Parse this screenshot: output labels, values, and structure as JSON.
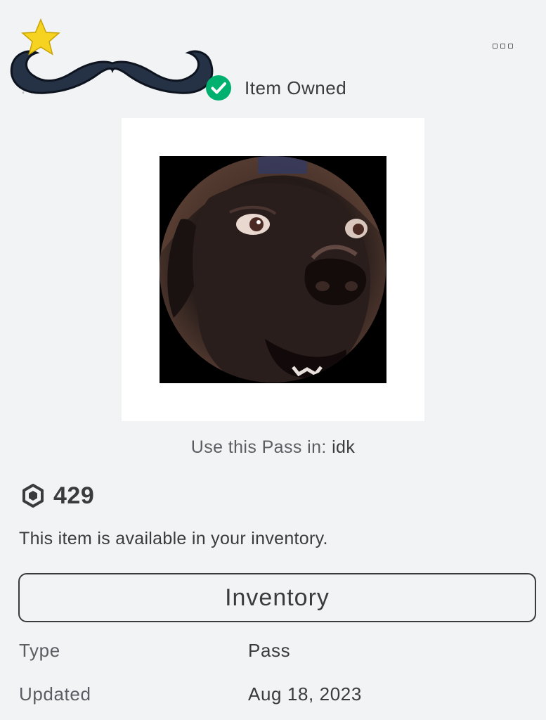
{
  "header": {
    "owned_label": "Item Owned"
  },
  "menu": {
    "icon": "more-options-icon"
  },
  "thumbnail": {
    "description": "dog-face-thumbnail"
  },
  "usage": {
    "prefix": "Use this Pass in:",
    "game_name": "idk"
  },
  "price": {
    "currency_icon": "robux-icon",
    "value": "429"
  },
  "availability_text": "This item is available in your inventory.",
  "inventory_button": {
    "label": "Inventory"
  },
  "details": {
    "type_label": "Type",
    "type_value": "Pass",
    "updated_label": "Updated",
    "updated_value": "Aug 18, 2023"
  },
  "colors": {
    "background": "#f2f3f5",
    "text": "#393b3d",
    "owned_green": "#00b06f"
  }
}
